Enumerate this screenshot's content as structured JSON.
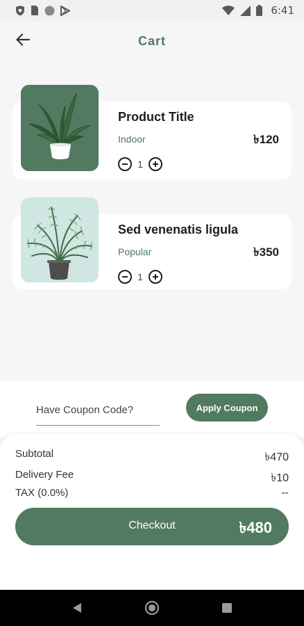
{
  "status_bar": {
    "time": "6:41",
    "icons": [
      "shield-icon",
      "sim-card-icon",
      "circle-icon",
      "play-store-icon",
      "wifi-icon",
      "signal-icon",
      "battery-icon"
    ]
  },
  "header": {
    "title": "Cart",
    "back_icon": "arrow-left-icon"
  },
  "cart": {
    "items": [
      {
        "name": "Product Title",
        "category": "Indoor",
        "price": "৳120",
        "quantity": "1",
        "image": "bird-of-paradise-plant",
        "image_bg": "#527a60"
      },
      {
        "name": "Sed venenatis ligula",
        "category": "Popular",
        "price": "৳350",
        "quantity": "1",
        "image": "palm-plant",
        "image_bg": "#cfe6e2"
      }
    ]
  },
  "coupon": {
    "placeholder": "Have Coupon Code?",
    "value": "",
    "apply_label": "Apply Coupon"
  },
  "summary": {
    "subtotal_label": "Subtotal",
    "subtotal_value": "৳470",
    "delivery_label": "Delivery Fee",
    "delivery_value": "৳10",
    "tax_label": "TAX (0.0%)",
    "tax_value": "--",
    "checkout_label": "Checkout",
    "checkout_total": "৳480"
  },
  "nav_bar": {
    "icons": [
      "back-triangle-icon",
      "home-circle-icon",
      "recents-square-icon"
    ]
  },
  "colors": {
    "accent": "#527a60",
    "background": "#f6f6f6",
    "card": "#ffffff",
    "thumb_light": "#cfe6e2"
  }
}
